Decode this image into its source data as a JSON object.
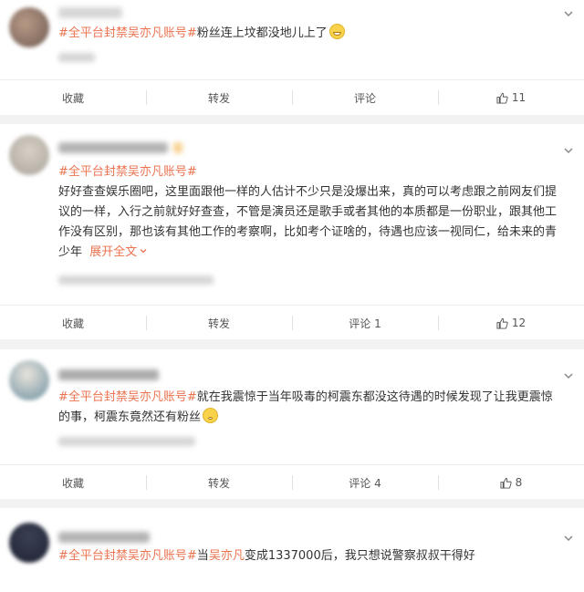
{
  "posts": [
    {
      "hashtag": "#全平台封禁吴亦凡账号#",
      "text": "粉丝连上坟都没地儿上了",
      "emoji": "grinning-face",
      "actions": {
        "collect": "收藏",
        "repost": "转发",
        "comment": "评论",
        "likes": "11"
      }
    },
    {
      "hashtag": "#全平台封禁吴亦凡账号#",
      "text": "好好查查娱乐圈吧，这里面跟他一样的人估计不少只是没爆出来，真的可以考虑跟之前网友们提议的一样，入行之前就好好查查，不管是演员还是歌手或者其他的本质都是一份职业，跟其他工作没有区别，那也该有其他工作的考察啊，比如考个证啥的，待遇也应该一视同仁，给未来的青少年",
      "expand": "展开全文",
      "actions": {
        "collect": "收藏",
        "repost": "转发",
        "comment": "评论 1",
        "likes": "12"
      }
    },
    {
      "hashtag": "#全平台封禁吴亦凡账号#",
      "text": "就在我震惊于当年吸毒的柯震东都没这待遇的时候发现了让我更震惊的事，柯震东竟然还有粉丝",
      "emoji": "puzzled-face",
      "actions": {
        "collect": "收藏",
        "repost": "转发",
        "comment": "评论 4",
        "likes": "8"
      }
    },
    {
      "hashtag": "#全平台封禁吴亦凡账号#",
      "text_pre": "当",
      "keyword": "吴亦凡",
      "text_post": "变成1337000后，我只想说警察叔叔干得好"
    }
  ]
}
